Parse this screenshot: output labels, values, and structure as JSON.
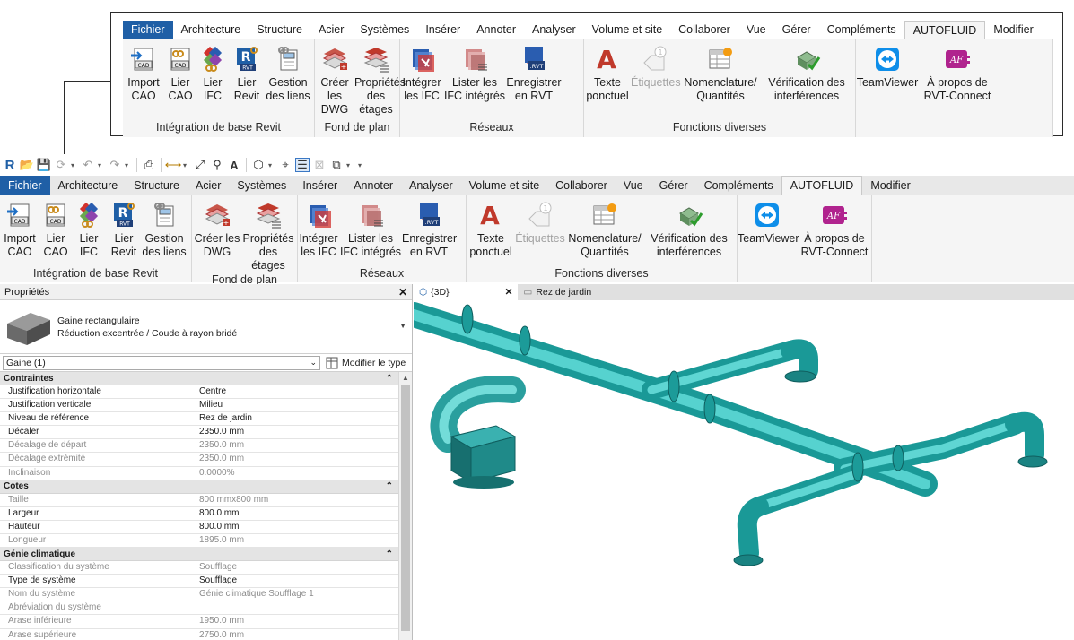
{
  "ribbon": {
    "tabs": [
      "Fichier",
      "Architecture",
      "Structure",
      "Acier",
      "Systèmes",
      "Insérer",
      "Annoter",
      "Analyser",
      "Volume et site",
      "Collaborer",
      "Vue",
      "Gérer",
      "Compléments",
      "AUTOFLUID",
      "Modifier"
    ],
    "active_tab": "AUTOFLUID",
    "panels": [
      {
        "title": "Intégration de base Revit",
        "buttons": [
          {
            "label": "Import CAO",
            "icon": "import-cad-icon"
          },
          {
            "label": "Lier CAO",
            "icon": "link-cad-icon"
          },
          {
            "label": "Lier IFC",
            "icon": "link-ifc-icon"
          },
          {
            "label": "Lier Revit",
            "icon": "link-revit-icon"
          },
          {
            "label": "Gestion des liens",
            "icon": "manage-links-icon"
          }
        ]
      },
      {
        "title": "Fond de plan",
        "buttons": [
          {
            "label": "Créer les DWG",
            "icon": "create-dwg-icon"
          },
          {
            "label": "Propriétés des étages",
            "icon": "level-properties-icon"
          }
        ]
      },
      {
        "title": "Réseaux",
        "buttons": [
          {
            "label": "Intégrer les IFC",
            "icon": "integrate-ifc-icon"
          },
          {
            "label": "Lister les IFC intégrés",
            "icon": "list-ifc-icon"
          },
          {
            "label": "Enregistrer en RVT",
            "icon": "save-rvt-icon"
          }
        ]
      },
      {
        "title": "Fonctions diverses",
        "buttons": [
          {
            "label": "Texte ponctuel",
            "icon": "text-icon"
          },
          {
            "label": "Étiquettes",
            "icon": "tag-icon",
            "disabled": true
          },
          {
            "label": "Nomenclature/ Quantités",
            "icon": "schedule-icon"
          },
          {
            "label": "Vérification des interférences",
            "icon": "interference-check-icon"
          }
        ]
      },
      {
        "title": "",
        "buttons": [
          {
            "label": "TeamViewer",
            "icon": "teamviewer-icon"
          },
          {
            "label": "À propos de RVT-Connect",
            "icon": "about-icon"
          }
        ]
      }
    ]
  },
  "properties": {
    "title": "Propriétés",
    "type_family": "Gaine rectangulaire",
    "type_name": "Réduction excentrée / Coude à rayon bridé",
    "instance_selector": "Gaine (1)",
    "edit_type_label": "Modifier le type",
    "groups": [
      {
        "name": "Contraintes",
        "rows": [
          {
            "name": "Justification horizontale",
            "value": "Centre",
            "editable": true
          },
          {
            "name": "Justification verticale",
            "value": "Milieu",
            "editable": true
          },
          {
            "name": "Niveau de référence",
            "value": "Rez de jardin",
            "editable": true
          },
          {
            "name": "Décaler",
            "value": "2350.0 mm",
            "editable": true
          },
          {
            "name": "Décalage de départ",
            "value": "2350.0 mm",
            "editable": false
          },
          {
            "name": "Décalage extrémité",
            "value": "2350.0 mm",
            "editable": false
          },
          {
            "name": "Inclinaison",
            "value": "0.0000%",
            "editable": false
          }
        ]
      },
      {
        "name": "Cotes",
        "rows": [
          {
            "name": "Taille",
            "value": "800 mmx800 mm",
            "editable": false
          },
          {
            "name": "Largeur",
            "value": "800.0 mm",
            "editable": true
          },
          {
            "name": "Hauteur",
            "value": "800.0 mm",
            "editable": true
          },
          {
            "name": "Longueur",
            "value": "1895.0 mm",
            "editable": false
          }
        ]
      },
      {
        "name": "Génie climatique",
        "rows": [
          {
            "name": "Classification du système",
            "value": "Soufflage",
            "editable": false
          },
          {
            "name": "Type de système",
            "value": "Soufflage",
            "editable": true
          },
          {
            "name": "Nom du système",
            "value": "Génie climatique Soufflage 1",
            "editable": false
          },
          {
            "name": "Abréviation du système",
            "value": "",
            "editable": false
          },
          {
            "name": "Arase inférieure",
            "value": "1950.0 mm",
            "editable": false
          },
          {
            "name": "Arase supérieure",
            "value": "2750.0 mm",
            "editable": false
          }
        ]
      }
    ]
  },
  "view_tabs": [
    {
      "label": "{3D}",
      "active": true,
      "icon": "3d-view-icon"
    },
    {
      "label": "Rez de jardin",
      "active": false,
      "icon": "floor-plan-icon"
    }
  ],
  "colors": {
    "duct": "#2bb5b3",
    "duct_dark": "#157f80",
    "file_tab": "#1f5fa6",
    "revit_r": "#1f5fa6"
  }
}
